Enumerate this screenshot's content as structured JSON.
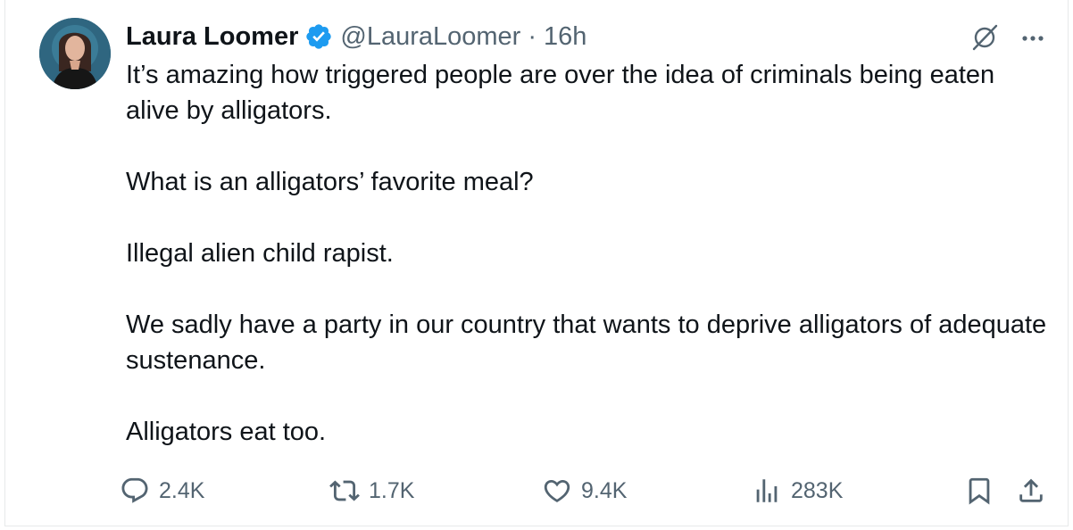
{
  "tweet": {
    "author_name": "Laura Loomer",
    "handle": "@LauraLoomer",
    "separator": "·",
    "time": "16h",
    "paragraphs": [
      "It’s amazing how triggered people are over the idea of criminals being eaten alive by alligators.",
      "What is an alligators’ favorite meal?",
      "Illegal alien child rapist.",
      "We sadly have a party in our country that wants to deprive alligators of adequate sustenance.",
      "Alligators eat too."
    ],
    "verified_color": "#1d9bf0"
  },
  "actions": {
    "replies": "2.4K",
    "reposts": "1.7K",
    "likes": "9.4K",
    "views": "283K"
  },
  "icons": {
    "reply": "reply-icon",
    "repost": "repost-icon",
    "like": "like-icon",
    "views": "views-icon",
    "bookmark": "bookmark-icon",
    "share": "share-icon",
    "grok": "grok-icon",
    "more": "more-icon"
  }
}
